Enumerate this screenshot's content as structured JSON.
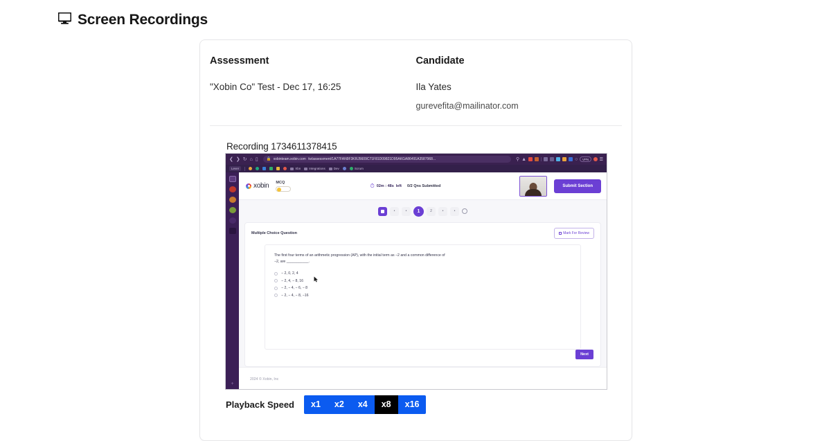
{
  "page": {
    "title": "Screen Recordings",
    "title_icon": "monitor-icon"
  },
  "card": {
    "assessment": {
      "label": "Assessment",
      "value": "\"Xobin Co\" Test - Dec 17, 16:25"
    },
    "candidate": {
      "label": "Candidate",
      "name": "Ila Yates",
      "email": "gurevefita@mailinator.com"
    },
    "recording": {
      "title": "Recording 1734611378415"
    }
  },
  "playback": {
    "label": "Playback Speed",
    "options": [
      "x1",
      "x2",
      "x4",
      "x8",
      "x16"
    ],
    "selected": "x8",
    "active_color": "#000000",
    "button_color": "#0b5bf0"
  },
  "video_frame": {
    "browser": {
      "url_prefix": "xobinteam.xobin.com",
      "url_path": "/w/assessment/1A77FAN9F3KRJ5609C71F81D09821D95AKGA86491A3587968...",
      "vpn_label": "VPN",
      "bookmarks": [
        "Lever",
        "Xbn",
        "Integrations",
        "Dev",
        "Scrum"
      ]
    },
    "app_header": {
      "brand": "xobin",
      "section_label": "MCQ",
      "timer": "02m : 48s",
      "timer_suffix": "left",
      "submitted": "0/2 Qns Submitted",
      "submit_button": "Submit Section",
      "webcam": "candidate-webcam"
    },
    "pagination": {
      "current": "1",
      "next": "2"
    },
    "question": {
      "type_label": "Multiple Choice Question",
      "review_button": "Mark For Review",
      "text": "The first four terms of an arithmetic progression (AP), with the initial term as −2 and a common difference of −2, are ___________.",
      "options": [
        "− 2, 0, 2, 4",
        "− 2, 4, − 8, 16",
        "− 2, − 4, − 6, − 8",
        "− 2, − 4, − 8, −16"
      ],
      "next_button": "Next"
    },
    "footer": {
      "copyright": "2024 © Xobin, Inc"
    }
  }
}
